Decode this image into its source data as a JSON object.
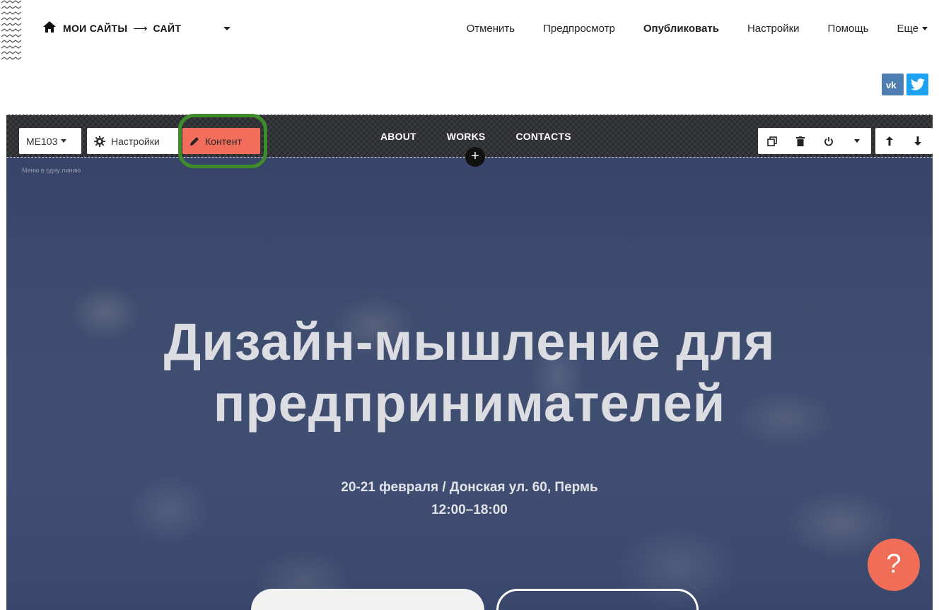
{
  "topbar": {
    "breadcrumb_root": "МОИ САЙТЫ",
    "breadcrumb_arrow": "⟶",
    "breadcrumb_current": "САЙТ",
    "nav": {
      "cancel": "Отменить",
      "preview": "Предпросмотр",
      "publish": "Опубликовать",
      "settings": "Настройки",
      "help": "Помощь",
      "more": "Еще"
    }
  },
  "social": {
    "vk": "vk",
    "twitter": "t"
  },
  "block_toolbar": {
    "block_code": "ME103",
    "settings_label": "Настройки",
    "content_label": "Контент",
    "note": "Меню в одну линию"
  },
  "site_menu": {
    "items": [
      "ABOUT",
      "WORKS",
      "CONTACTS"
    ]
  },
  "hero": {
    "headline_line1": "Дизайн-мышление для",
    "headline_line2": "предпринимателей",
    "details_line1": "20-21 февраля / Донская ул. 60, Пермь",
    "details_line2": "12:00–18:00"
  },
  "help_button": "?",
  "colors": {
    "content_button": "#f26d5b",
    "highlight_ring": "#3f8d2a",
    "help_button": "#f06e58",
    "hero_overlay": "#3d4a6b"
  }
}
